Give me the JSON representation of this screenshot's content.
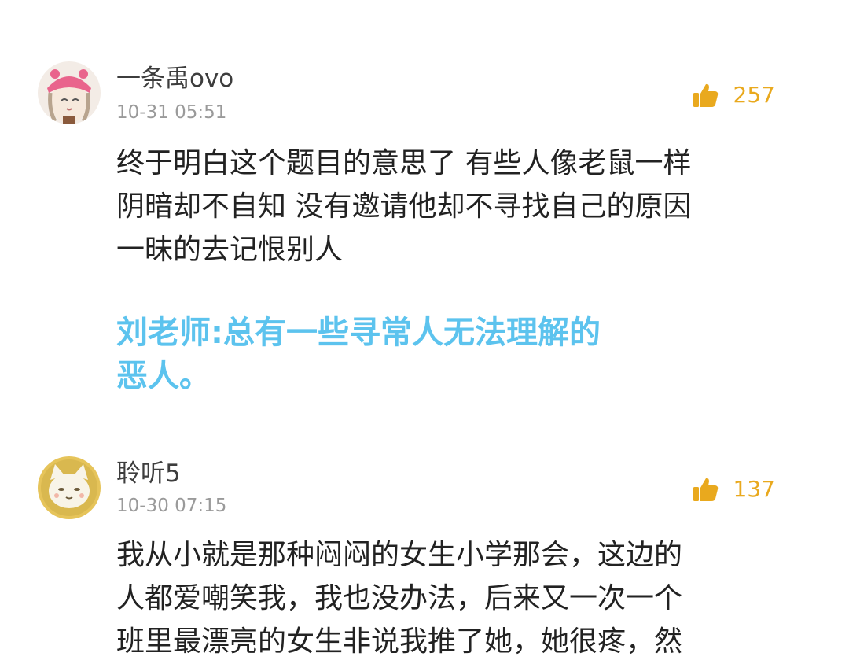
{
  "comments": [
    {
      "username": "一条禹ovo",
      "timestamp": "10-31 05:51",
      "likes": "257",
      "avatar_icon": "pink-hat-anime-girl-avatar",
      "body_lines": [
        "终于明白这个题目的意思了 有些人像老鼠一样",
        "阴暗却不自知 没有邀请他却不寻找自己的原因",
        "一昧的去记恨别人"
      ],
      "reply_lines": [
        "刘老师:总有一些寻常人无法理解的",
        "恶人。"
      ]
    },
    {
      "username": "聆听5",
      "timestamp": "10-30 07:15",
      "likes": "137",
      "avatar_icon": "cat-avatar",
      "body_lines": [
        "我从小就是那种闷闷的女生小学那会，这边的",
        "人都爱嘲笑我，我也没办法，后来又一次一个",
        "班里最漂亮的女生非说我推了她，她很疼，然"
      ]
    }
  ],
  "colors": {
    "like_accent": "#e9a91e",
    "reply_text": "#5cc3ee",
    "timestamp": "#9a9a9a"
  }
}
